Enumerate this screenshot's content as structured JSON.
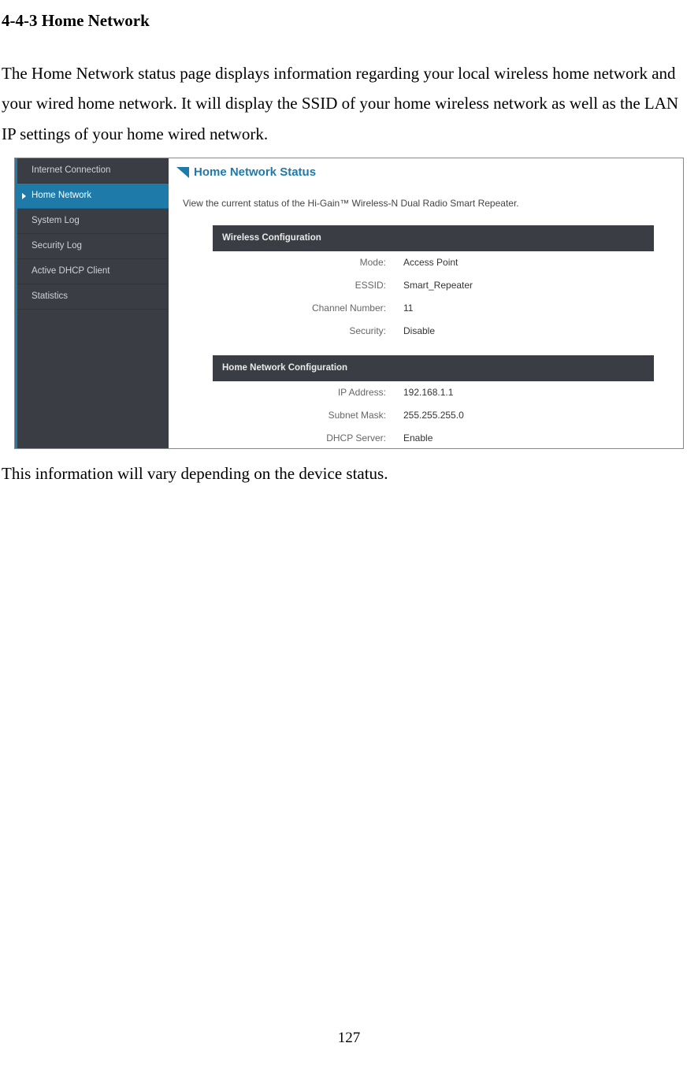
{
  "heading": "4-4-3 Home Network",
  "intro": "The Home Network status page displays information regarding your local wireless home network and your wired home network.    It will display the SSID of your home wireless network as well as the LAN IP settings of your home wired network.",
  "outro": "This information will vary depending on the device status.",
  "page_number": "127",
  "screenshot": {
    "sidebar": {
      "items": [
        {
          "label": "Internet Connection",
          "active": false
        },
        {
          "label": "Home Network",
          "active": true
        },
        {
          "label": "System Log",
          "active": false
        },
        {
          "label": "Security Log",
          "active": false
        },
        {
          "label": "Active DHCP Client",
          "active": false
        },
        {
          "label": "Statistics",
          "active": false
        }
      ]
    },
    "title": "Home Network Status",
    "subtitle": "View the current status of the Hi-Gain™ Wireless-N Dual Radio Smart Repeater.",
    "panels": {
      "wireless": {
        "header": "Wireless Configuration",
        "rows": {
          "mode": {
            "k": "Mode:",
            "v": "Access Point"
          },
          "essid": {
            "k": "ESSID:",
            "v": "Smart_Repeater"
          },
          "channel": {
            "k": "Channel Number:",
            "v": "11"
          },
          "security": {
            "k": "Security:",
            "v": "Disable"
          }
        }
      },
      "network": {
        "header": "Home Network Configuration",
        "rows": {
          "ip": {
            "k": "IP Address:",
            "v": "192.168.1.1"
          },
          "mask": {
            "k": "Subnet Mask:",
            "v": "255.255.255.0"
          },
          "dhcp": {
            "k": "DHCP Server:",
            "v": "Enable"
          }
        }
      }
    }
  }
}
